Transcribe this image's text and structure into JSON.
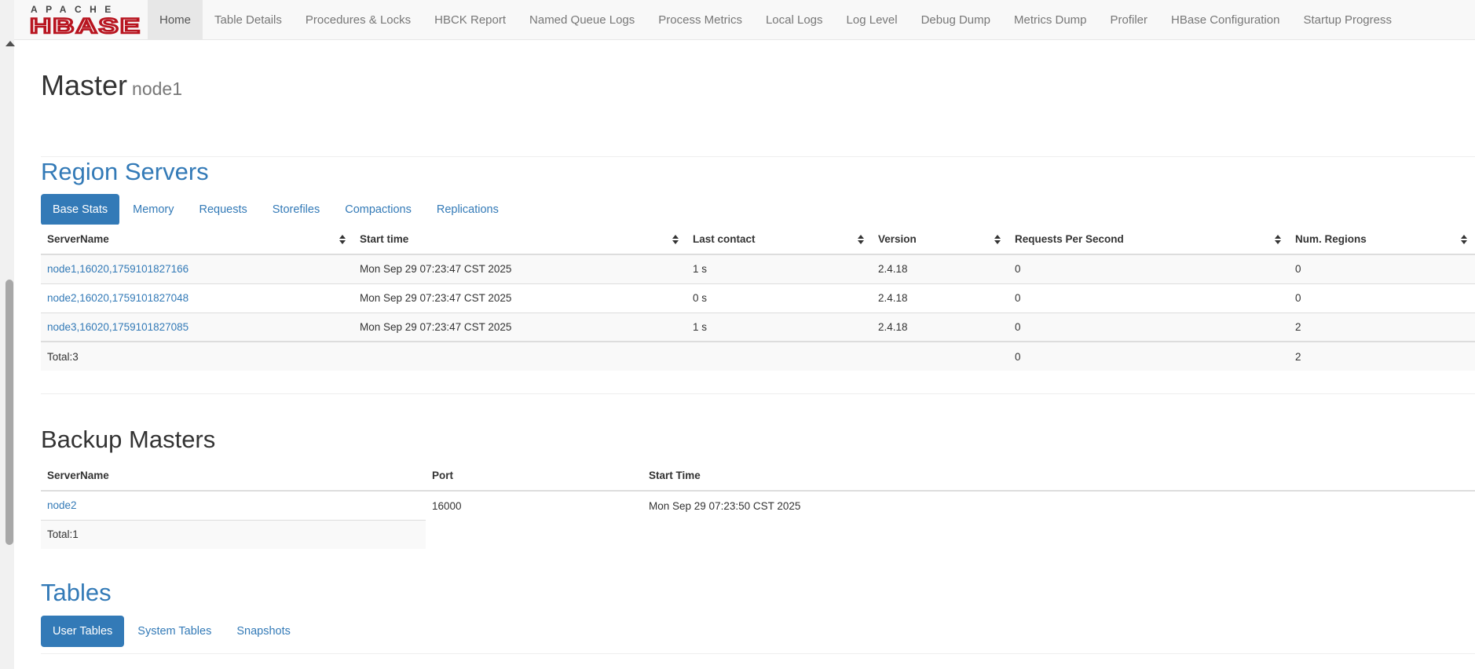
{
  "brand": {
    "top": "APACHE",
    "bottom": "HBASE"
  },
  "nav": [
    {
      "label": "Home",
      "active": true
    },
    {
      "label": "Table Details"
    },
    {
      "label": "Procedures & Locks"
    },
    {
      "label": "HBCK Report"
    },
    {
      "label": "Named Queue Logs"
    },
    {
      "label": "Process Metrics"
    },
    {
      "label": "Local Logs"
    },
    {
      "label": "Log Level"
    },
    {
      "label": "Debug Dump"
    },
    {
      "label": "Metrics Dump"
    },
    {
      "label": "Profiler"
    },
    {
      "label": "HBase Configuration"
    },
    {
      "label": "Startup Progress"
    }
  ],
  "header": {
    "title": "Master",
    "subtitle": "node1"
  },
  "region_servers": {
    "title": "Region Servers",
    "tabs": [
      "Base Stats",
      "Memory",
      "Requests",
      "Storefiles",
      "Compactions",
      "Replications"
    ],
    "columns": [
      "ServerName",
      "Start time",
      "Last contact",
      "Version",
      "Requests Per Second",
      "Num. Regions"
    ],
    "rows": [
      [
        "node1,16020,1759101827166",
        "Mon Sep 29 07:23:47 CST 2025",
        "1 s",
        "2.4.18",
        "0",
        "0"
      ],
      [
        "node2,16020,1759101827048",
        "Mon Sep 29 07:23:47 CST 2025",
        "0 s",
        "2.4.18",
        "0",
        "0"
      ],
      [
        "node3,16020,1759101827085",
        "Mon Sep 29 07:23:47 CST 2025",
        "1 s",
        "2.4.18",
        "0",
        "2"
      ]
    ],
    "total": {
      "label": "Total:3",
      "requests": "0",
      "regions": "2"
    }
  },
  "backup_masters": {
    "title": "Backup Masters",
    "columns": [
      "ServerName",
      "Port",
      "Start Time"
    ],
    "rows": [
      [
        "node2",
        "16000",
        "Mon Sep 29 07:23:50 CST 2025"
      ]
    ],
    "total": "Total:1"
  },
  "tables": {
    "title": "Tables",
    "tabs": [
      "User Tables",
      "System Tables",
      "Snapshots"
    ]
  },
  "colors": {
    "link": "#337ab7",
    "brand_red": "#b8141f",
    "navbar_bg": "#f8f8f8"
  }
}
